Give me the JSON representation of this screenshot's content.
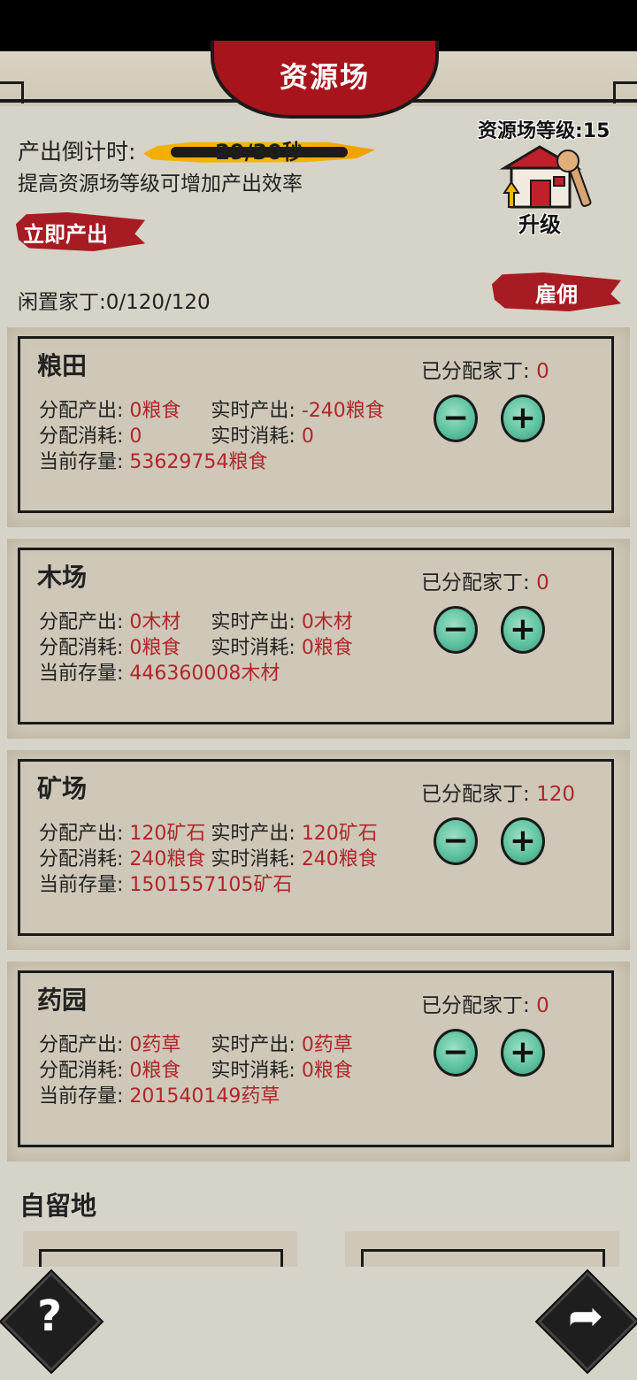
{
  "header": {
    "title": "资源场"
  },
  "status": {
    "countdown_label": "产出倒计时:",
    "countdown_value": "29/30秒",
    "hint": "提高资源场等级可增加产出效率",
    "produce_now": "立即产出",
    "level_label": "资源场等级:15",
    "upgrade": "升级",
    "idle_workers": "闲置家丁:0/120/120",
    "hire": "雇佣"
  },
  "labels": {
    "assign_out": "分配产出: ",
    "live_out": "实时产出: ",
    "assign_cost": "分配消耗: ",
    "live_cost": "实时消耗: ",
    "stock": "当前存量: ",
    "assigned": "已分配家丁: "
  },
  "cards": [
    {
      "name": "粮田",
      "assign_out": "0粮食",
      "live_out": "-240粮食",
      "assign_cost": "0",
      "live_cost": "0",
      "stock": "53629754粮食",
      "assigned": "0"
    },
    {
      "name": "木场",
      "assign_out": "0木材",
      "live_out": "0木材",
      "assign_cost": "0粮食",
      "live_cost": "0粮食",
      "stock": "446360008木材",
      "assigned": "0"
    },
    {
      "name": "矿场",
      "assign_out": "120矿石",
      "live_out": "120矿石",
      "assign_cost": "240粮食",
      "live_cost": "240粮食",
      "stock": "1501557105矿石",
      "assigned": "120"
    },
    {
      "name": "药园",
      "assign_out": "0药草",
      "live_out": "0药草",
      "assign_cost": "0粮食",
      "live_cost": "0粮食",
      "stock": "201540149药草",
      "assigned": "0"
    }
  ],
  "self_land": {
    "title": "自留地"
  },
  "buttons": {
    "minus": "−",
    "plus": "+",
    "help": "?",
    "share": "➦"
  },
  "colors": {
    "accent_red": "#a8141b",
    "value_red": "#b0262a",
    "jade": "#5fc3a0"
  }
}
